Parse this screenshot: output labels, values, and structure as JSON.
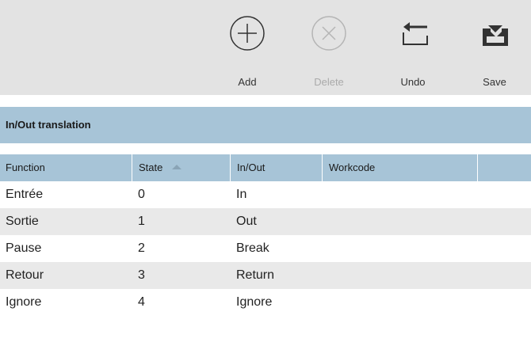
{
  "toolbar": {
    "add_label": "Add",
    "delete_label": "Delete",
    "undo_label": "Undo",
    "save_label": "Save"
  },
  "section": {
    "title": "In/Out translation"
  },
  "table": {
    "headers": {
      "function": "Function",
      "state": "State",
      "inout": "In/Out",
      "workcode": "Workcode"
    },
    "sort_column": "State",
    "sort_direction": "ascending",
    "rows": [
      {
        "function": "Entrée",
        "state": "0",
        "inout": "In",
        "workcode": ""
      },
      {
        "function": "Sortie",
        "state": "1",
        "inout": "Out",
        "workcode": ""
      },
      {
        "function": "Pause",
        "state": "2",
        "inout": "Break",
        "workcode": ""
      },
      {
        "function": "Retour",
        "state": "3",
        "inout": "Return",
        "workcode": ""
      },
      {
        "function": "Ignore",
        "state": "4",
        "inout": "Ignore",
        "workcode": ""
      }
    ]
  },
  "colors": {
    "header_blue": "#a7c4d7",
    "toolbar_gray": "#e3e3e3",
    "alt_row": "#e9e9e9"
  }
}
